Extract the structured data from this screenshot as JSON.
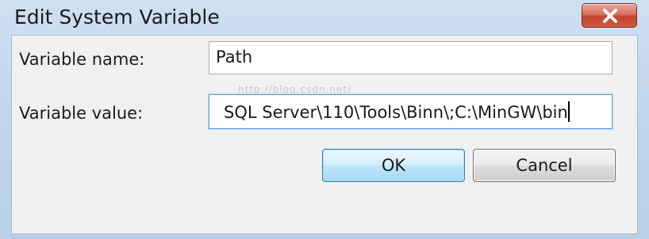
{
  "window": {
    "title": "Edit System Variable"
  },
  "form": {
    "name_label": "Variable name:",
    "name_value": "Path",
    "value_label": "Variable value:",
    "value_value": "SQL Server\\110\\Tools\\Binn\\;C:\\MinGW\\bin"
  },
  "watermark": "http://blog.csdn.net/",
  "buttons": {
    "ok_label": "OK",
    "cancel_label": "Cancel"
  },
  "icons": {
    "close": "close-icon"
  },
  "colors": {
    "close_button": "#c4432d",
    "focus_border": "#5b9bd5",
    "ok_button": "#bee6fd"
  }
}
